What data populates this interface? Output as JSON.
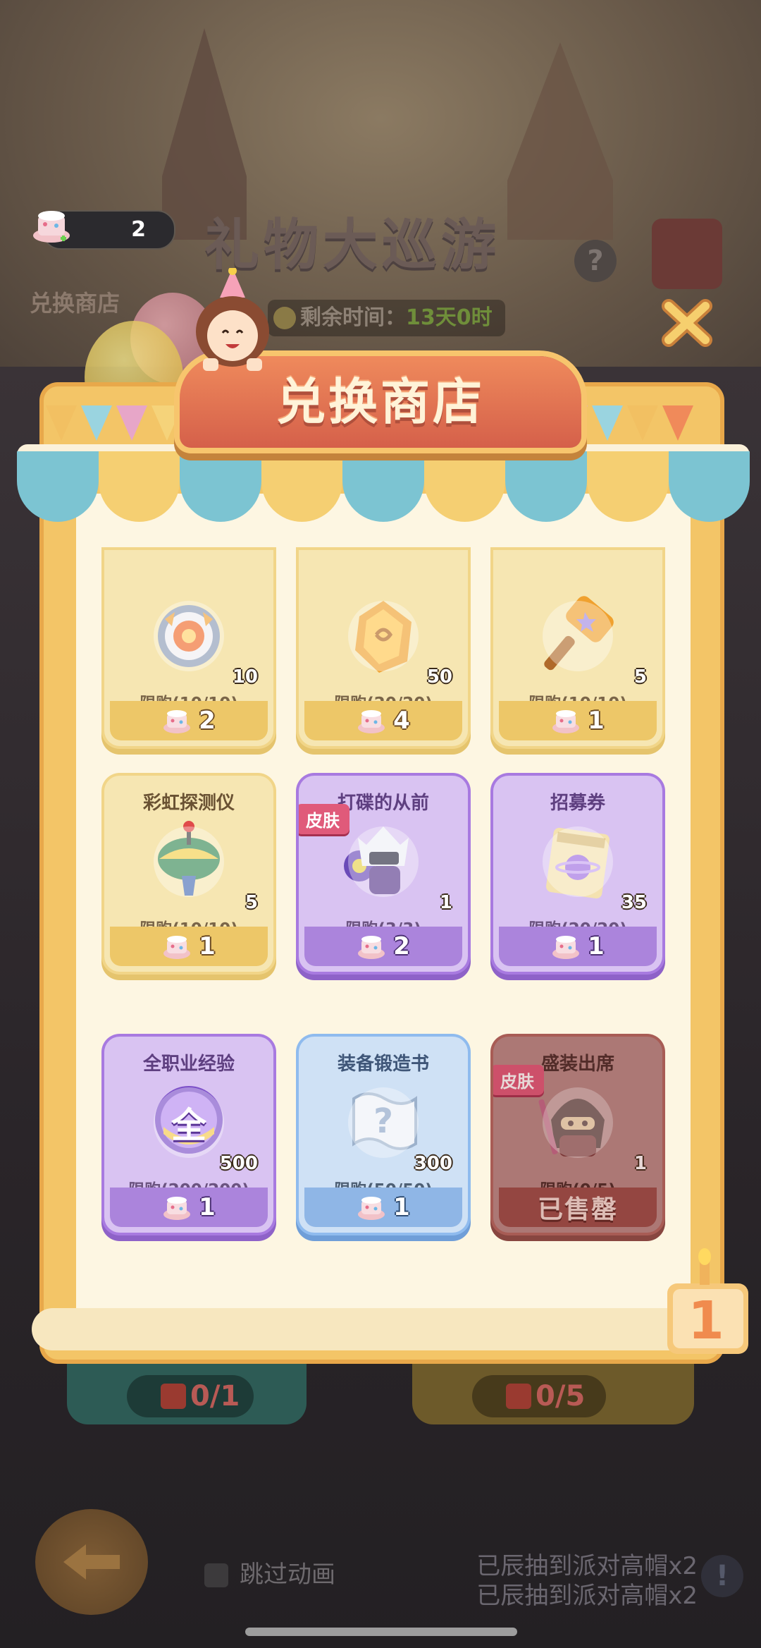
{
  "hud": {
    "currency_count": "2",
    "shop_label": "兑换商店",
    "event_title": "礼物大巡游",
    "timer_label": "剩余时间：",
    "timer_value": "13天0时"
  },
  "modal": {
    "title": "兑换商店",
    "badge_number": "1"
  },
  "items": [
    {
      "name": "",
      "qty": "10",
      "limit": "限购(10/10)",
      "price": "2",
      "theme": "gold",
      "icon": "gear-badge-icon"
    },
    {
      "name": "",
      "qty": "50",
      "limit": "限购(20/20)",
      "price": "4",
      "theme": "gold",
      "icon": "amber-crystal-icon"
    },
    {
      "name": "",
      "qty": "5",
      "limit": "限购(10/10)",
      "price": "1",
      "theme": "gold",
      "icon": "hammer-icon"
    },
    {
      "name": "彩虹探测仪",
      "qty": "5",
      "limit": "限购(10/10)",
      "price": "1",
      "theme": "gold",
      "icon": "spinning-top-icon"
    },
    {
      "name": "打碟的从前",
      "qty": "1",
      "limit": "限购(3/3)",
      "price": "2",
      "theme": "purple",
      "icon": "dj-hero-icon",
      "tag": "皮肤"
    },
    {
      "name": "招募券",
      "qty": "35",
      "limit": "限购(20/20)",
      "price": "1",
      "theme": "purple",
      "icon": "recruit-ticket-icon"
    },
    {
      "name": "全职业经验",
      "qty": "500",
      "limit": "限购(200/200)",
      "price": "1",
      "theme": "purple",
      "icon": "exp-orb-icon",
      "orb_text": "全"
    },
    {
      "name": "装备锻造书",
      "qty": "300",
      "limit": "限购(50/50)",
      "price": "1",
      "theme": "blue",
      "icon": "scroll-icon"
    },
    {
      "name": "盛装出席",
      "qty": "1",
      "limit": "限购(0/5)",
      "price": "",
      "theme": "red",
      "icon": "masked-hero-icon",
      "tag": "皮肤",
      "sold_out": "已售罄"
    }
  ],
  "background": {
    "counter_left": "0/1",
    "counter_right": "0/5",
    "skip_label": "跳过动画",
    "ticker_line1": "已辰抽到派对高帽x2",
    "ticker_line2": "已辰抽到派对高帽x2"
  },
  "colors": {
    "gold_card": "#f6e6b2",
    "purple_card": "#d9c3f2",
    "blue_card": "#cfe1f5",
    "sold_out_card": "#b78a88",
    "title_banner": "#d5604a"
  }
}
